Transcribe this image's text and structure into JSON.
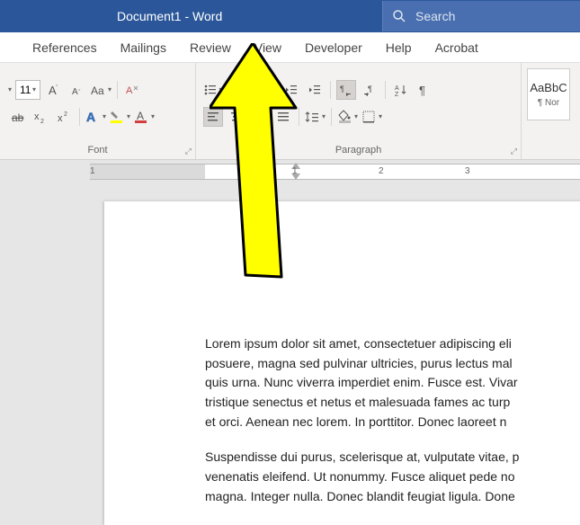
{
  "titlebar": {
    "title": "Document1  -  Word",
    "search_placeholder": "Search"
  },
  "tabs": [
    "References",
    "Mailings",
    "Review",
    "View",
    "Developer",
    "Help",
    "Acrobat"
  ],
  "font": {
    "size": "11",
    "group_label": "Font"
  },
  "paragraph": {
    "group_label": "Paragraph"
  },
  "styles": {
    "preview": "AaBbC",
    "name": "¶ Nor"
  },
  "ruler": {
    "labels": [
      "1",
      "1",
      "2",
      "3"
    ]
  },
  "document": {
    "paragraphs": [
      [
        "Lorem ipsum dolor sit amet, consectetuer adipiscing eli",
        "posuere, magna sed pulvinar ultricies, purus lectus mal",
        "quis urna. Nunc viverra imperdiet enim. Fusce est. Vivar",
        "tristique senectus et netus et malesuada fames ac turp",
        "et orci. Aenean nec lorem. In porttitor. Donec laoreet n"
      ],
      [
        "Suspendisse dui purus, scelerisque at, vulputate vitae, p",
        "venenatis eleifend. Ut nonummy. Fusce aliquet pede no",
        "magna. Integer nulla. Donec blandit feugiat ligula. Done"
      ]
    ]
  }
}
